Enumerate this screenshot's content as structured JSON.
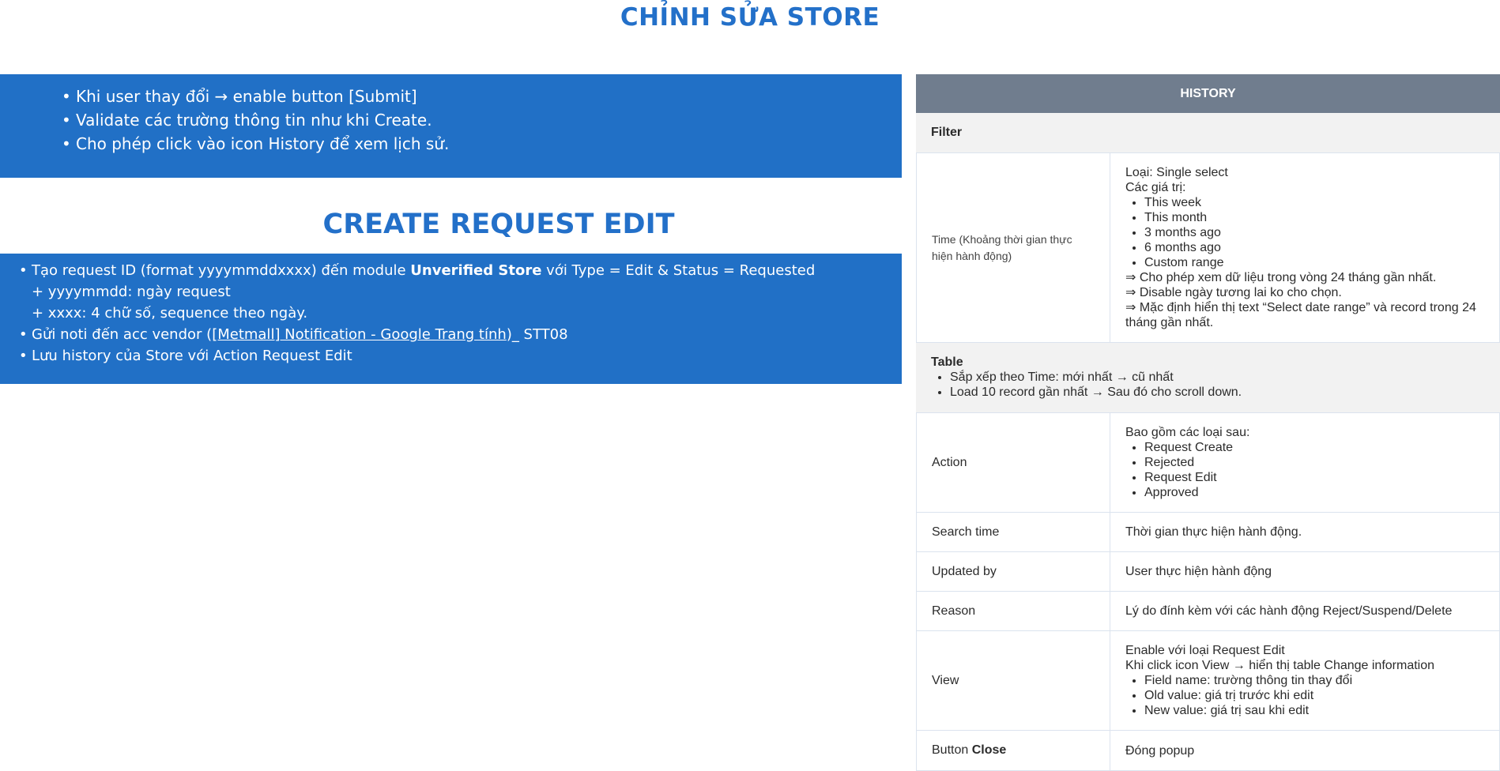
{
  "page_title": "CHỈNH SỬA STORE",
  "edit_notes": [
    "Khi user thay đổi → enable button [Submit]",
    "Validate các trường thông tin như khi Create.",
    "Cho phép click vào icon History để xem lịch sử."
  ],
  "section_title": "CREATE REQUEST EDIT",
  "request": {
    "line1_pre": "Tạo request ID (format yyyymmddxxxx) đến module ",
    "line1_bold": "Unverified Store",
    "line1_post": " với Type = Edit & Status = Requested",
    "line2": "+ yyyymmdd: ngày request",
    "line3": "+ xxxx: 4 chữ số, sequence theo ngày.",
    "line4_pre": "Gửi noti đến acc vendor (",
    "line4_link": "[Metmall] Notification - Google Trang tính",
    "line4_post": ")_ STT08",
    "line5": "Lưu history của Store với Action Request Edit"
  },
  "history": {
    "header": "HISTORY",
    "filter_label": "Filter",
    "time_label": "Time (Khoảng thời gian thực hiện hành động)",
    "time_value": {
      "type": "Loại: Single select",
      "values_label": "Các giá trị:",
      "options": [
        "This week",
        "This month",
        "3 months ago",
        "6 months ago",
        "Custom range"
      ],
      "note1": "⇒ Cho phép xem dữ liệu trong vòng 24 tháng gần nhất.",
      "note2": "⇒ Disable ngày tương lai ko cho chọn.",
      "note3": "⇒ Mặc định hiển thị text “Select date range” và record trong 24 tháng gần nhất."
    },
    "table_label": "Table",
    "table_items": [
      "Sắp xếp theo Time: mới nhất → cũ nhất",
      "Load 10 record gần nhất → Sau đó cho scroll down."
    ],
    "action_label": "Action",
    "action_intro": "Bao gồm các loại sau:",
    "action_items": [
      "Request Create",
      "Rejected",
      "Request Edit",
      "Approved"
    ],
    "search_time_label": "Search time",
    "search_time_value": "Thời gian thực hiện hành động.",
    "updated_by_label": "Updated by",
    "updated_by_value": "User thực hiện hành động",
    "reason_label": "Reason",
    "reason_value": "Lý do đính kèm với các hành động Reject/Suspend/Delete",
    "view_label": "View",
    "view_line1": "Enable với loại Request Edit",
    "view_line2": "Khi click icon View → hiển thị table Change information",
    "view_items": [
      "Field name: trường thông tin thay đổi",
      "Old value: giá trị trước khi edit",
      "New value: giá trị sau khi edit"
    ],
    "close_label_pre": "Button ",
    "close_label_bold": "Close",
    "close_value": "Đóng popup"
  }
}
